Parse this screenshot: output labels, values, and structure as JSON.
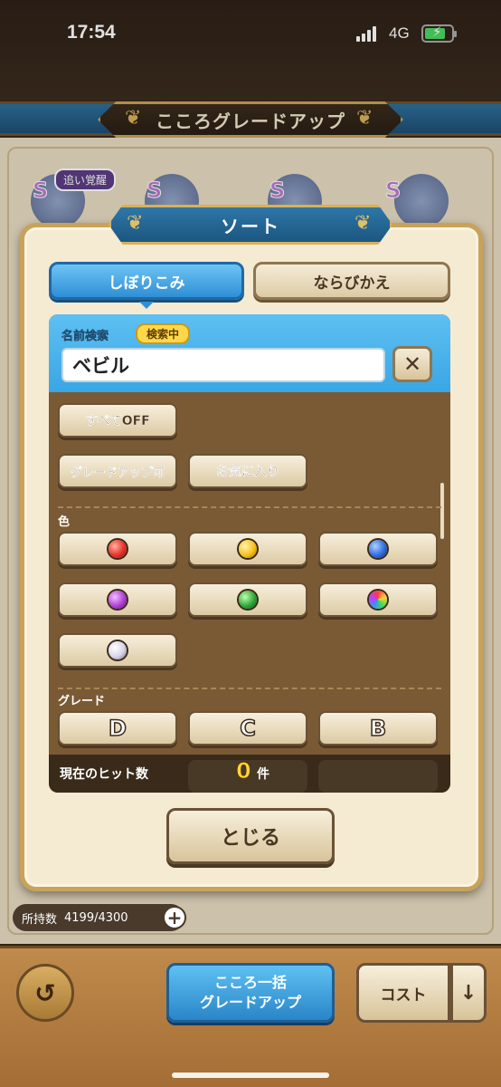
{
  "status_bar": {
    "time": "17:54",
    "network": "4G"
  },
  "header": {
    "title": "こころグレードアップ"
  },
  "background": {
    "awaken_tag": "追い覚醒",
    "grade_marks": [
      "S",
      "S",
      "S",
      "S"
    ]
  },
  "modal": {
    "title": "ソート",
    "tabs": {
      "filter": "しぼりこみ",
      "sort": "ならびかえ"
    },
    "search": {
      "label": "名前検索",
      "badge": "検索中",
      "value": "ベビル",
      "clear": "✕"
    },
    "buttons": {
      "all_off": "すべてOFF",
      "upgradable": "グレードアップ可",
      "favorite": "お気に入り"
    },
    "color_section": {
      "label": "色",
      "orbs": [
        {
          "name": "red",
          "color": "#e8322a"
        },
        {
          "name": "yellow",
          "color": "#f5c21a"
        },
        {
          "name": "blue",
          "color": "#2f6fe0"
        },
        {
          "name": "purple",
          "color": "#b140d8"
        },
        {
          "name": "green",
          "color": "#2ea83a"
        },
        {
          "name": "rainbow",
          "color": "#ff7ad0"
        },
        {
          "name": "white",
          "color": "#d8d4e8"
        }
      ]
    },
    "grade_section": {
      "label": "グレード",
      "grades": [
        "D",
        "C",
        "B"
      ]
    },
    "hits": {
      "label": "現在のヒット数",
      "count": "0",
      "unit": "件"
    },
    "close": "とじる"
  },
  "footer": {
    "count_label": "所持数",
    "count_value": "4199/4300",
    "plus": "+",
    "bulk_line1": "こころ一括",
    "bulk_line2": "グレードアップ",
    "cost": "コスト",
    "order": "↓"
  }
}
